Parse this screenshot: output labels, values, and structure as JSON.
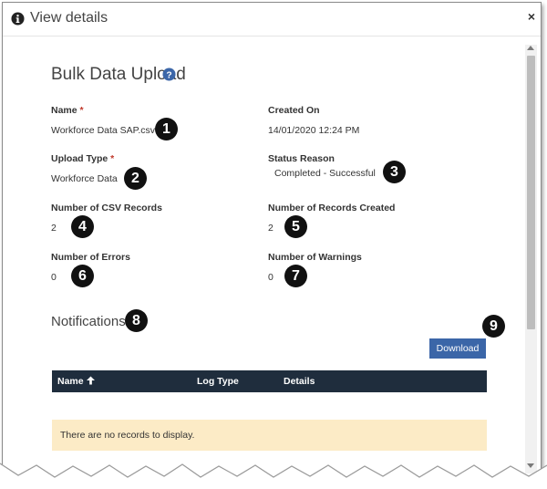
{
  "dialog": {
    "title": "View details",
    "close_glyph": "×"
  },
  "form": {
    "title": "Bulk Data Upload",
    "required_marker": "*",
    "fields": {
      "name": {
        "label": "Name",
        "value": "Workforce Data SAP.csv",
        "required": true
      },
      "created_on": {
        "label": "Created On",
        "value": "14/01/2020 12:24 PM"
      },
      "upload_type": {
        "label": "Upload Type",
        "value": "Workforce Data",
        "required": true
      },
      "status_reason": {
        "label": "Status Reason",
        "value": "Completed - Successful"
      },
      "csv_records": {
        "label": "Number of CSV Records",
        "value": "2"
      },
      "records_created": {
        "label": "Number of Records Created",
        "value": "2"
      },
      "errors": {
        "label": "Number of Errors",
        "value": "0"
      },
      "warnings": {
        "label": "Number of Warnings",
        "value": "0"
      }
    }
  },
  "notifications": {
    "title": "Notifications",
    "download_label": "Download",
    "columns": [
      "Name",
      "Log Type",
      "Details"
    ],
    "empty_message": "There are no records to display."
  },
  "callouts": [
    "1",
    "2",
    "3",
    "4",
    "5",
    "6",
    "7",
    "8",
    "9"
  ],
  "icons": {
    "header": "info-icon",
    "help": "help-icon",
    "sort": "arrow-up-icon",
    "close": "close-icon"
  },
  "colors": {
    "accent": "#3b66a8",
    "grid_header": "#1f2d3d",
    "empty_row": "#fcebc6",
    "required": "#c0392b"
  }
}
